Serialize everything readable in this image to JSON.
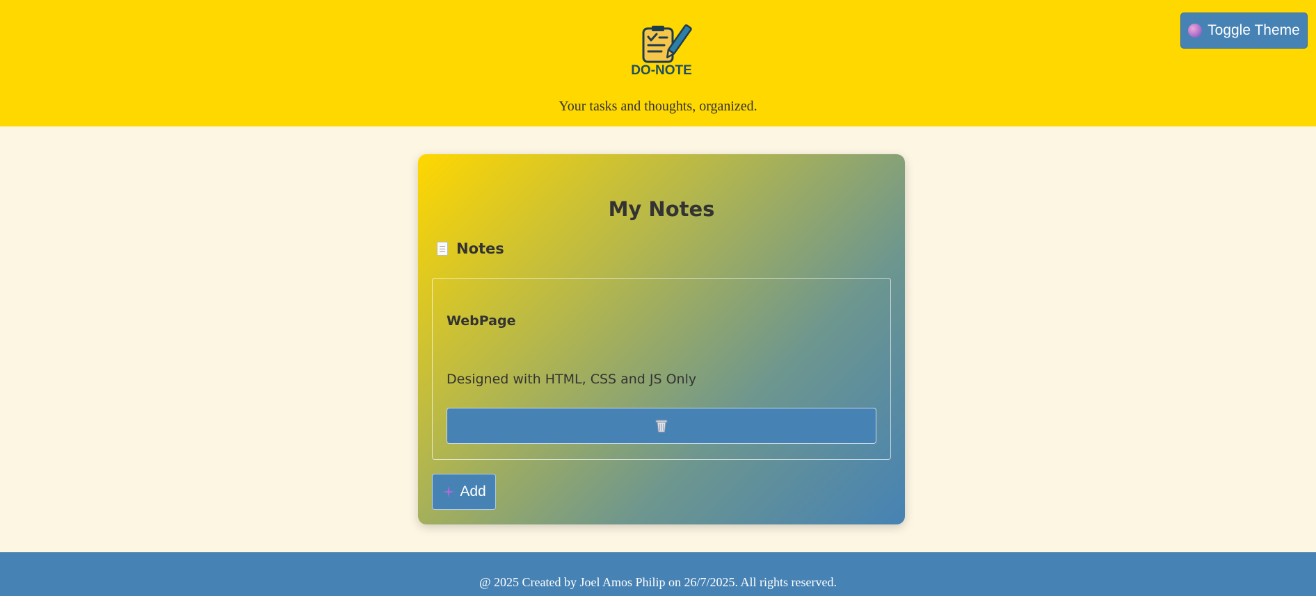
{
  "header": {
    "logo_text": "DO-NOTE",
    "tagline": "Your tasks and thoughts, organized.",
    "toggle_label": "Toggle Theme",
    "toggle_icon": "brain-icon",
    "background": "#ffd800"
  },
  "main": {
    "title": "My Notes",
    "notes_heading": "Notes",
    "notes_icon": "notepad-icon",
    "notes": [
      {
        "title": "WebPage",
        "body": "Designed with HTML, CSS and JS Only",
        "delete_icon": "trash-icon"
      }
    ],
    "add_label": "Add",
    "add_icon": "plus-icon"
  },
  "footer": {
    "text": "@ 2025 Created by Joel Amos Philip on 26/7/2025. All rights reserved."
  },
  "colors": {
    "accent": "#4682b4",
    "brand_yellow": "#ffd800",
    "page_background": "#fdf6e3",
    "text": "#333333"
  }
}
